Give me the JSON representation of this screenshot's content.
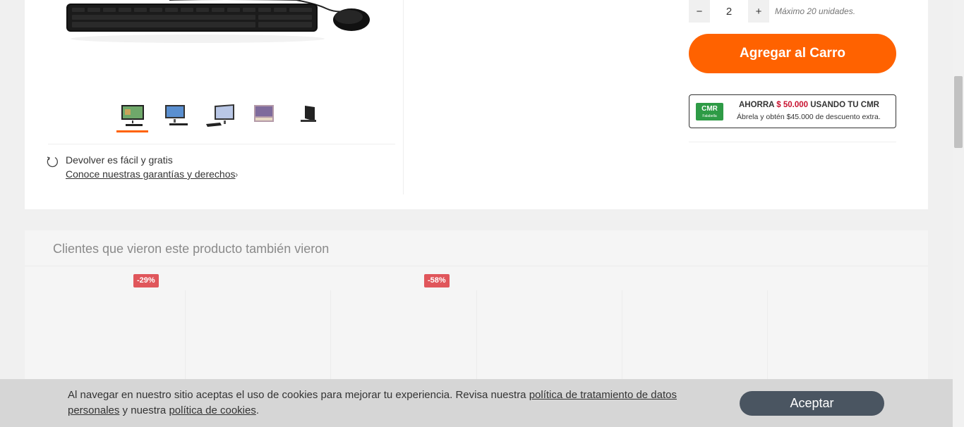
{
  "gallery": {
    "thumbnails": [
      {
        "icon": "all-in-one-pc-green-wallpaper",
        "active": true
      },
      {
        "icon": "all-in-one-pc-blue-wallpaper",
        "active": false
      },
      {
        "icon": "all-in-one-pc-angle-view",
        "active": false
      },
      {
        "icon": "all-in-one-pc-purple-wallpaper",
        "active": false
      },
      {
        "icon": "all-in-one-pc-back-view",
        "active": false
      }
    ]
  },
  "returns": {
    "title": "Devolver es fácil y gratis",
    "link": "Conoce nuestras garantías y derechos"
  },
  "purchase": {
    "qty_minus": "−",
    "qty_value": "2",
    "qty_plus": "+",
    "qty_max": "Máximo 20 unidades.",
    "add_to_cart": "Agregar al Carro",
    "accent_color": "#ff6200"
  },
  "cmr": {
    "logo_text": "CMR",
    "logo_sub": "Falabella",
    "save_prefix": "AHORRA",
    "save_amount": "$ 50.000",
    "save_suffix": "USANDO TU CMR",
    "subtitle": "Ábrela y obtén $45.000 de descuento extra."
  },
  "recommendations": {
    "title": "Clientes que vieron este producto también vieron",
    "badges": [
      "-29%",
      "-58%"
    ],
    "badge_color": "#e0565b"
  },
  "cookies": {
    "text_1": "Al navegar en nuestro sitio aceptas el uso de cookies para mejorar tu experiencia. Revisa nuestra ",
    "link_1": "política de tratamiento de datos personales",
    "text_2": " y nuestra ",
    "link_2": "política de cookies",
    "text_3": ".",
    "accept": "Aceptar"
  }
}
